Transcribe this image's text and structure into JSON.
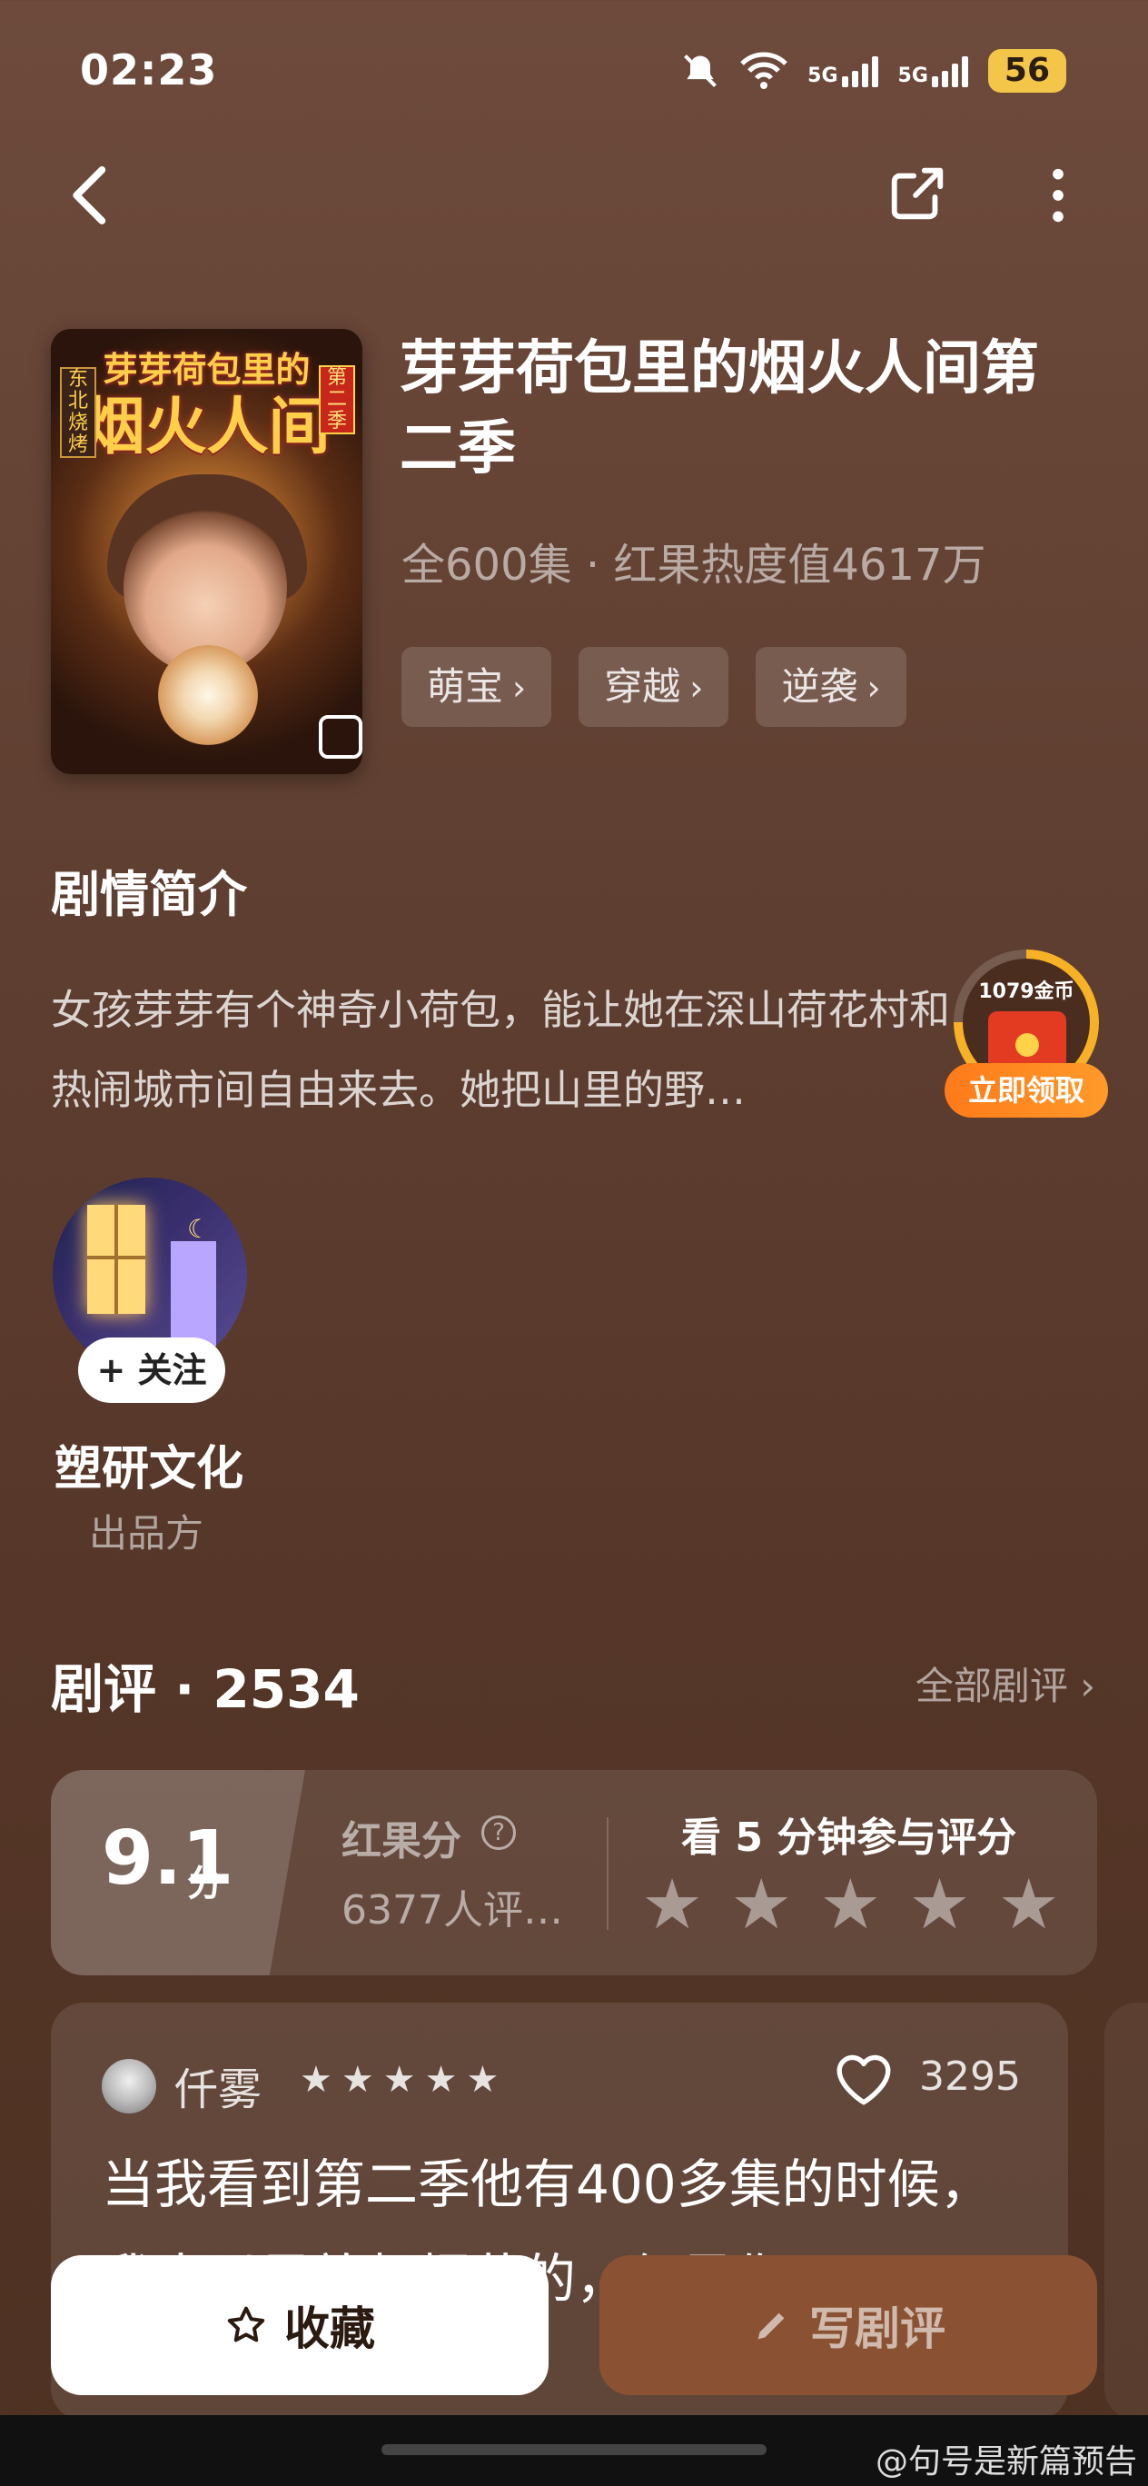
{
  "status_bar": {
    "time": "02:23",
    "signal1": "5G",
    "signal2": "5G",
    "battery": "56",
    "icons": [
      "bell-muted-icon",
      "wifi-icon",
      "signal-icon",
      "signal-icon",
      "battery-icon"
    ]
  },
  "nav": {
    "back_icon": "chevron-left-icon",
    "share_icon": "share-icon",
    "more_icon": "more-vertical-icon"
  },
  "cover": {
    "title_line1": "芽芽荷包里的",
    "title_line2": "烟火人间",
    "tag_left": "东北烧烤",
    "tag_right": "第二季"
  },
  "drama": {
    "title": "芽芽荷包里的烟火人间第二季",
    "meta": "全600集 · 红果热度值4617万",
    "tags": [
      "萌宝",
      "穿越",
      "逆袭"
    ]
  },
  "synopsis": {
    "heading": "剧情简介",
    "text": "女孩芽芽有个神奇小荷包，能让她在深山荷花村和热闹城市间自由来去。她把山里的野…"
  },
  "reward": {
    "coins": "1079金币",
    "button": "立即领取"
  },
  "producer": {
    "follow": "+ 关注",
    "name": "塑研文化",
    "role": "出品方"
  },
  "reviews": {
    "heading": "剧评 · 2534",
    "all_link": "全部剧评 ›"
  },
  "score": {
    "value": "9.1",
    "unit": "分",
    "label": "红果分",
    "count": "6377人评…",
    "rate_prompt": "看 5 分钟参与评分",
    "rate_stars": 5
  },
  "review": {
    "user": "仟雾",
    "stars": 5,
    "likes": "3295",
    "text": "当我看到第二季他有400多集的时候，我本以是放起烟花的，但是你"
  },
  "actions": {
    "collect": "收藏",
    "write": "写剧评"
  },
  "watermark": "@句号是新篇预告"
}
